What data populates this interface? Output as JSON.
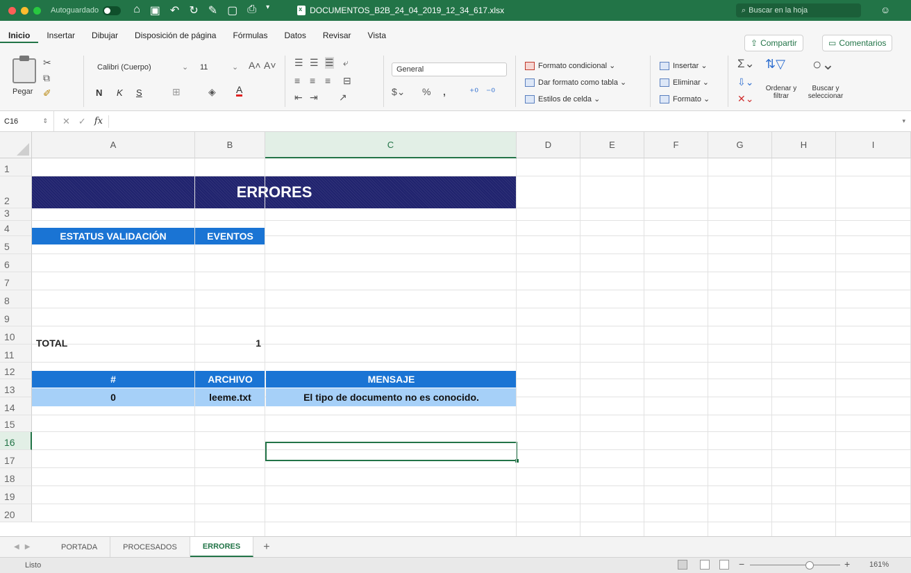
{
  "titlebar": {
    "autosave_label": "Autoguardado",
    "document_title": "DOCUMENTOS_B2B_24_04_2019_12_34_617.xlsx",
    "search_placeholder": "Buscar en la hoja"
  },
  "ribbon_tabs": [
    "Inicio",
    "Insertar",
    "Dibujar",
    "Disposición de página",
    "Fórmulas",
    "Datos",
    "Revisar",
    "Vista"
  ],
  "ribbon_actions": {
    "share_label": "Compartir",
    "comments_label": "Comentarios"
  },
  "ribbon": {
    "paste_label": "Pegar",
    "font_name": "Calibri (Cuerpo)",
    "font_size": "11",
    "bold": "N",
    "italic": "K",
    "underline": "S",
    "number_format": "General",
    "conditional_format": "Formato condicional",
    "format_as_table": "Dar formato como tabla",
    "cell_styles": "Estilos de celda",
    "insert": "Insertar",
    "delete": "Eliminar",
    "format": "Formato",
    "sort_filter": "Ordenar y filtrar",
    "find_select": "Buscar y seleccionar"
  },
  "formula_bar": {
    "name_box": "C16",
    "fx": "fx",
    "formula": ""
  },
  "grid": {
    "columns": [
      "A",
      "B",
      "C",
      "D",
      "E",
      "F",
      "G",
      "H",
      "I"
    ],
    "selected_column": "C",
    "rows": [
      "1",
      "2",
      "3",
      "4",
      "5",
      "6",
      "7",
      "8",
      "9",
      "10",
      "11",
      "12",
      "13",
      "14",
      "15",
      "16",
      "17",
      "18",
      "19",
      "20"
    ],
    "selected_row": "16"
  },
  "sheet": {
    "title": "ERRORES",
    "status_header": "ESTATUS VALIDACIÓN",
    "events_header": "EVENTOS",
    "total_label": "TOTAL",
    "total_value": "1",
    "errors_headers": [
      "#",
      "ARCHIVO",
      "MENSAJE"
    ],
    "errors_rows": [
      [
        "0",
        "leeme.txt",
        "El tipo de documento no es conocido."
      ]
    ]
  },
  "sheet_tabs": [
    "PORTADA",
    "PROCESADOS",
    "ERRORES"
  ],
  "active_sheet_tab": "ERRORES",
  "add_sheet": "+",
  "statusbar": {
    "status": "Listo",
    "zoom": "161%"
  },
  "colors": {
    "accent": "#227447",
    "title_band": "#20236e",
    "header_blue": "#1a74d4",
    "row_light_blue": "#a6d0f8"
  }
}
